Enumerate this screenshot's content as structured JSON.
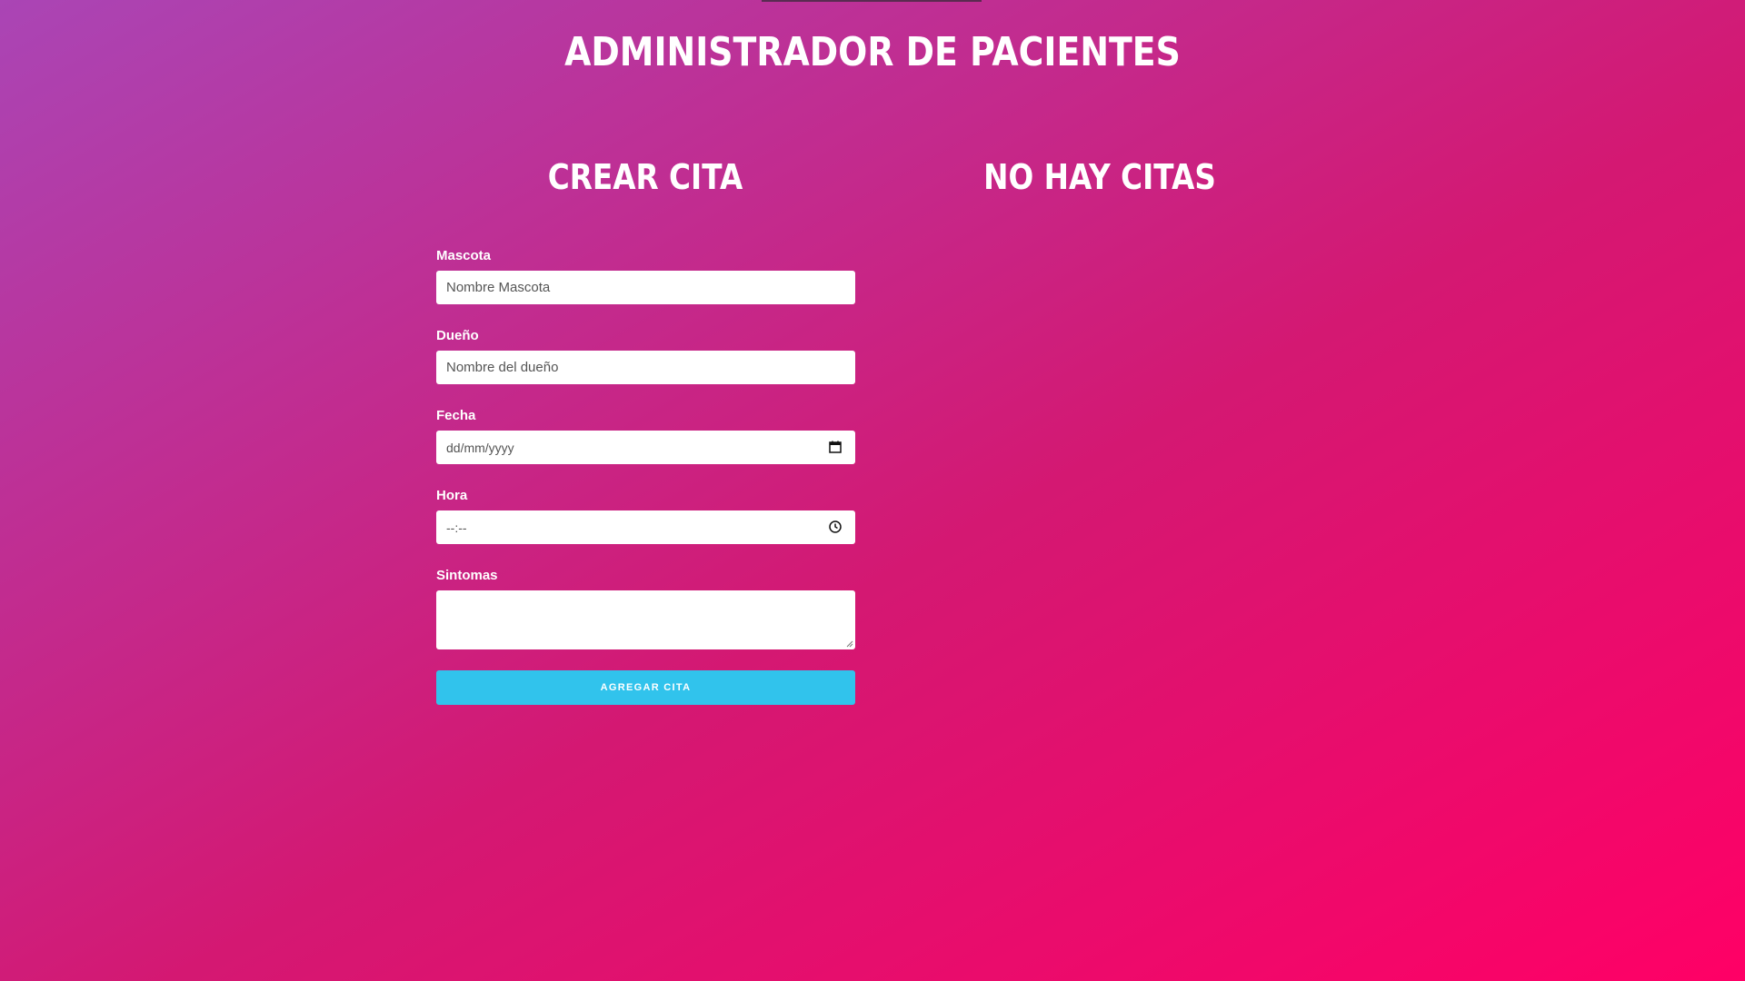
{
  "header": {
    "title": "Administrador de Pacientes"
  },
  "form_panel": {
    "heading": "Crear Cita",
    "fields": {
      "mascota": {
        "label": "Mascota",
        "placeholder": "Nombre Mascota",
        "value": ""
      },
      "dueno": {
        "label": "Dueño",
        "placeholder": "Nombre del dueño",
        "value": ""
      },
      "fecha": {
        "label": "Fecha",
        "display": "dd/mm/yyyy",
        "icon": "calendar-icon"
      },
      "hora": {
        "label": "Hora",
        "display": "--:--",
        "icon": "clock-icon"
      },
      "sintomas": {
        "label": "Sintomas",
        "value": ""
      }
    },
    "submit_label": "Agregar Cita"
  },
  "list_panel": {
    "heading": "No hay citas"
  },
  "colors": {
    "gradient_start": "#aa45b5",
    "gradient_end": "#ff0066",
    "button": "#31c3ec",
    "text": "#ffffff"
  }
}
